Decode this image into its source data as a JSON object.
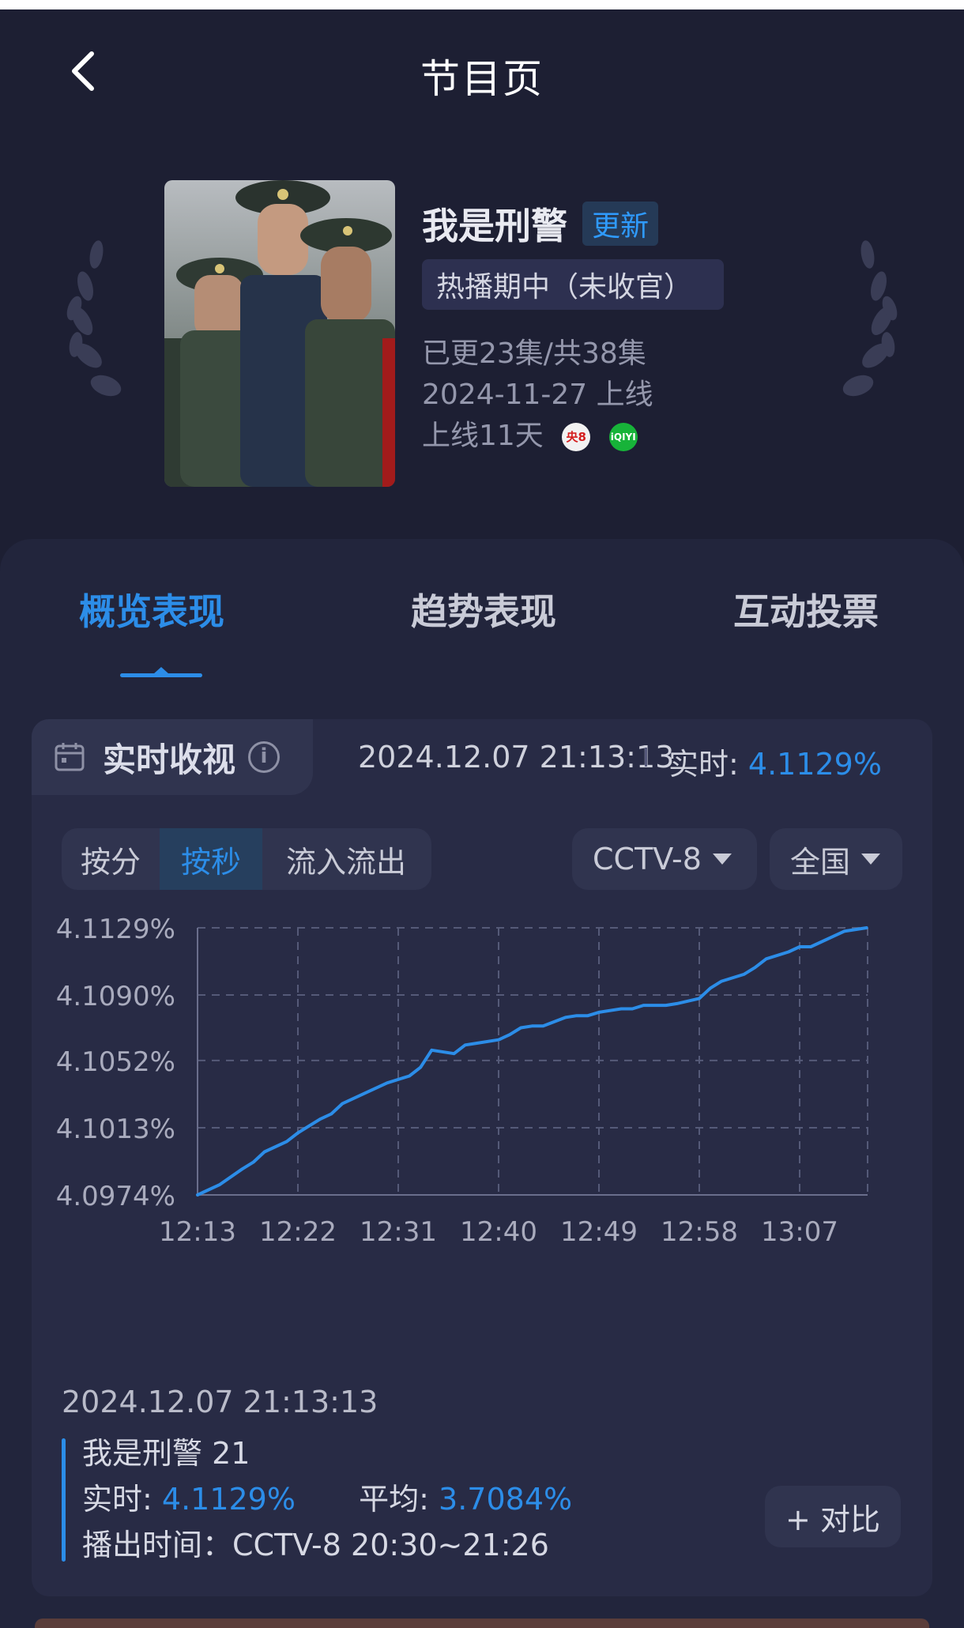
{
  "header": {
    "title": "节目页"
  },
  "show": {
    "name": "我是刑警",
    "update_badge": "更新",
    "status": "热播期中（未收官）",
    "episodes": "已更23集/共38集",
    "release": "2024-11-27 上线",
    "days_online": "上线11天",
    "platforms": [
      {
        "name": "央8",
        "icon": "cctv8-logo-icon",
        "color": "#d41e1e"
      },
      {
        "name": "iQIYI",
        "icon": "iqiyi-logo-icon",
        "color": "#17b339"
      }
    ],
    "poster_title": "我是刑警"
  },
  "tabs": [
    {
      "label": "概览表现",
      "active": true
    },
    {
      "label": "趋势表现",
      "active": false
    },
    {
      "label": "互动投票",
      "active": false
    }
  ],
  "realtime": {
    "label": "实时收视",
    "timestamp": "2024.12.07 21:13:13",
    "rt_label": "实时: ",
    "rt_value": "4.1129%"
  },
  "controls": {
    "segments": [
      {
        "label": "按分",
        "active": false
      },
      {
        "label": "按秒",
        "active": true
      },
      {
        "label": "流入流出",
        "active": false
      }
    ],
    "channel": "CCTV-8",
    "region": "全国"
  },
  "chart_data": {
    "type": "line",
    "title": "",
    "xlabel": "",
    "ylabel": "",
    "x_ticks": [
      "12:13",
      "12:22",
      "12:31",
      "12:40",
      "12:49",
      "12:58",
      "13:07"
    ],
    "y_ticks": [
      "4.1129%",
      "4.1090%",
      "4.1052%",
      "4.1013%",
      "4.0974%"
    ],
    "ylim": [
      4.0974,
      4.1129
    ],
    "grid": true,
    "series": [
      {
        "color": "#2c8de8",
        "x": [
          "12:13",
          "12:15",
          "12:17",
          "12:18",
          "12:19",
          "12:21",
          "12:22",
          "12:24",
          "12:25",
          "12:26",
          "12:28",
          "12:29",
          "12:30",
          "12:32",
          "12:33",
          "12:34",
          "12:36",
          "12:37",
          "12:38",
          "12:40",
          "12:41",
          "12:42",
          "12:43",
          "12:44",
          "12:46",
          "12:47",
          "12:48",
          "12:49",
          "12:51",
          "12:52",
          "12:53",
          "12:55",
          "12:56",
          "12:58",
          "12:59",
          "13:00",
          "13:02",
          "13:03",
          "13:04",
          "13:06",
          "13:07",
          "13:08",
          "13:10",
          "13:11",
          "13:13"
        ],
        "y": [
          4.0974,
          4.098,
          4.0989,
          4.0993,
          4.0999,
          4.1005,
          4.101,
          4.1018,
          4.1021,
          4.1027,
          4.1033,
          4.1036,
          4.1039,
          4.1043,
          4.1048,
          4.1058,
          4.1056,
          4.1061,
          4.1062,
          4.1064,
          4.1067,
          4.1071,
          4.1072,
          4.1072,
          4.1077,
          4.1078,
          4.1078,
          4.108,
          4.1082,
          4.1082,
          4.1084,
          4.1084,
          4.1085,
          4.1088,
          4.1094,
          4.1098,
          4.1102,
          4.1106,
          4.1111,
          4.1115,
          4.1118,
          4.1118,
          4.1124,
          4.1127,
          4.1129
        ]
      }
    ]
  },
  "footer": {
    "timestamp": "2024.12.07 21:13:13",
    "episode": "我是刑警 21",
    "rt_label": "实时: ",
    "rt_value": "4.1129%",
    "avg_label": "平均: ",
    "avg_value": "3.7084%",
    "airtime": "播出时间：CCTV-8 20:30~21:26",
    "compare_button": "+ 对比"
  }
}
